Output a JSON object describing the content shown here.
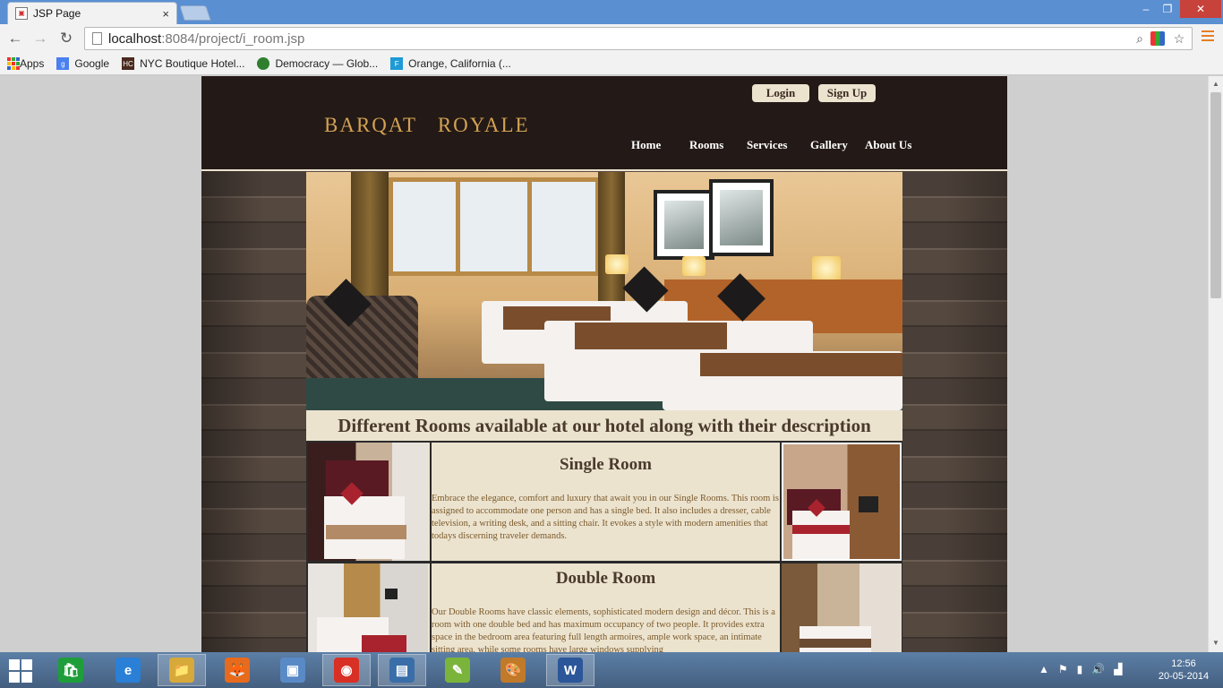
{
  "browser": {
    "tab_title": "JSP Page",
    "tab_close": "×",
    "url_host": "localhost",
    "url_rest": ":8084/project/i_room.jsp",
    "window_controls": {
      "minimize": "–",
      "maximize": "❐",
      "close": "✕"
    },
    "nav": {
      "back": "←",
      "forward": "→",
      "reload": "↻"
    }
  },
  "bookmarks": [
    {
      "label": "Apps",
      "icon": "apps-grid-icon"
    },
    {
      "label": "Google",
      "icon": "google-icon",
      "mark": "g",
      "color": "#4a80f0"
    },
    {
      "label": "NYC Boutique Hotel...",
      "icon": "hc-icon",
      "mark": "HC",
      "color": "#4a2a1e"
    },
    {
      "label": "Democracy — Glob...",
      "icon": "globe-icon",
      "mark": "●",
      "color": "#2f7f2f"
    },
    {
      "label": "Orange, California (...",
      "icon": "f-icon",
      "mark": "F",
      "color": "#1e9ad6"
    }
  ],
  "site": {
    "logo": "BARQAT   ROYALE",
    "login": "Login",
    "signup": "Sign Up",
    "nav": {
      "home": "Home",
      "rooms": "Rooms",
      "services": "Services",
      "gallery": "Gallery",
      "about": "About Us"
    },
    "heading": "Different Rooms available at our hotel along with their description",
    "rooms": [
      {
        "title": "Single Room",
        "description": "Embrace the elegance, comfort and luxury that await you in our Single Rooms. This room is assigned to accommodate one person and has a single bed. It also includes a dresser, cable television, a writing desk, and a sitting chair. It evokes a style with modern amenities that todays discerning traveler demands."
      },
      {
        "title": "Double Room",
        "description": "Our Double Rooms have classic elements, sophisticated modern design and décor. This is a room with one double bed and has maximum occupancy of two people. It provides extra space in the bedroom area featuring full length armoires, ample work space, an intimate sitting area, while some rooms have large windows supplying"
      }
    ]
  },
  "taskbar": {
    "apps": [
      {
        "name": "store-icon",
        "mark": "🛍",
        "color": "#1e9e3a"
      },
      {
        "name": "internet-explorer-icon",
        "mark": "e",
        "color": "#2a7fd6"
      },
      {
        "name": "file-explorer-icon",
        "mark": "📁",
        "color": "#d7a93a",
        "active": true
      },
      {
        "name": "firefox-icon",
        "mark": "🦊",
        "color": "#e86a1c"
      },
      {
        "name": "virtualbox-icon",
        "mark": "▣",
        "color": "#5a8ac6"
      },
      {
        "name": "chrome-icon",
        "mark": "◉",
        "color": "#d93025",
        "active": true
      },
      {
        "name": "remote-desktop-icon",
        "mark": "▤",
        "color": "#3a6ea8",
        "active": true
      },
      {
        "name": "notepad-icon",
        "mark": "✎",
        "color": "#7bb43a"
      },
      {
        "name": "paint-icon",
        "mark": "🎨",
        "color": "#c07a2a"
      },
      {
        "name": "word-icon",
        "mark": "W",
        "color": "#2b579a",
        "active": true
      }
    ],
    "time": "12:56",
    "date": "20-05-2014"
  }
}
